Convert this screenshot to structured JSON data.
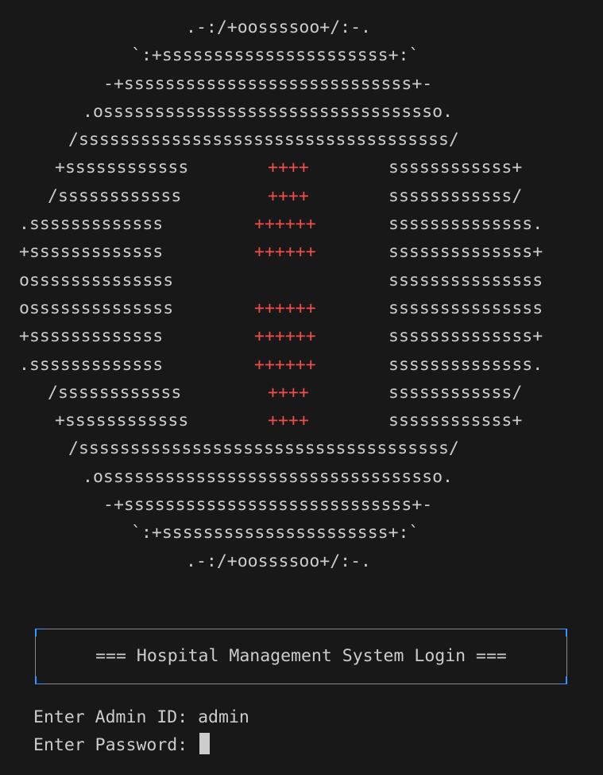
{
  "terminal": {
    "ascii_art": {
      "rows": [
        {
          "left": ".-:/+oossssoo+/:-.",
          "cross": "",
          "right": ""
        },
        {
          "left": "`:+ssssssssssssssssssssss+:`",
          "cross": "",
          "right": ""
        },
        {
          "left": "-+ssssssssssssssssssssssssssss+-",
          "cross": "",
          "right": ""
        },
        {
          "left": ".osssssssssssssssssssssssssssssssso.",
          "cross": "",
          "right": ""
        },
        {
          "left": "/ssssssssssssssssssssssssssssssssssss/",
          "cross": "",
          "right": ""
        },
        {
          "left": "+ssssssssssss",
          "cross": "++++",
          "right": "ssssssssssss+"
        },
        {
          "left": "/ssssssssssss",
          "cross": "++++",
          "right": "ssssssssssss/"
        },
        {
          "left": ".sssssssssssss",
          "cross": "++++++",
          "right": "ssssssssssssss."
        },
        {
          "left": "+sssssssssssss",
          "cross": "++++++",
          "right": "ssssssssssssss+"
        },
        {
          "left": "ossssssssssssss",
          "cross": "",
          "right": "sssssssssssssss"
        },
        {
          "left": "ossssssssssssss",
          "cross": "++++++",
          "right": "sssssssssssssss"
        },
        {
          "left": "+sssssssssssss",
          "cross": "++++++",
          "right": "ssssssssssssss+"
        },
        {
          "left": ".sssssssssssss",
          "cross": "++++++",
          "right": "ssssssssssssss."
        },
        {
          "left": "/ssssssssssss",
          "cross": "++++",
          "right": "ssssssssssss/"
        },
        {
          "left": "+ssssssssssss",
          "cross": "++++",
          "right": "ssssssssssss+"
        },
        {
          "left": "/ssssssssssssssssssssssssssssssssssss/",
          "cross": "",
          "right": ""
        },
        {
          "left": ".osssssssssssssssssssssssssssssssso.",
          "cross": "",
          "right": ""
        },
        {
          "left": "-+ssssssssssssssssssssssssssss+-",
          "cross": "",
          "right": ""
        },
        {
          "left": "`:+ssssssssssssssssssssss+:`",
          "cross": "",
          "right": ""
        },
        {
          "left": ".-:/+oossssoo+/:-.",
          "cross": "",
          "right": ""
        }
      ]
    },
    "login_box": {
      "title": "=== Hospital Management System Login ==="
    },
    "prompts": {
      "admin_id_label": "Enter Admin ID: ",
      "admin_id_value": "admin",
      "password_label": "Enter Password: "
    },
    "colors": {
      "background": "#181818",
      "text": "#cccccc",
      "cross": "#f14c4c",
      "box_corner_accent": "#3794ff"
    }
  }
}
